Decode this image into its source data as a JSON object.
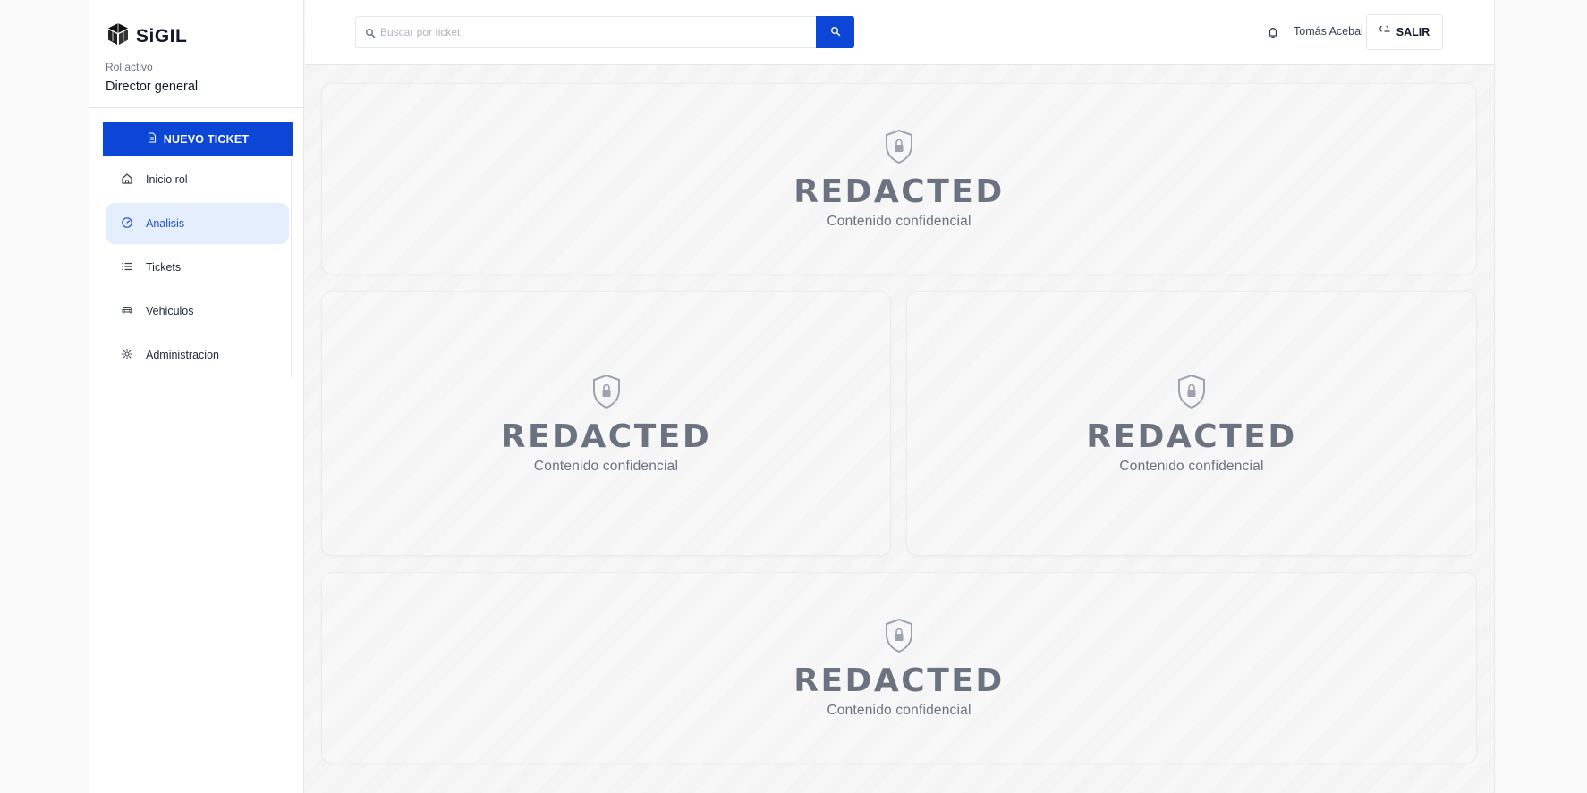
{
  "brand": {
    "name": "SiGIL",
    "logo_icon": "cube-logo-icon"
  },
  "role": {
    "label": "Rol activo",
    "value": "Director general"
  },
  "new_ticket": {
    "label": "NUEVO TICKET",
    "icon": "document-icon"
  },
  "nav": {
    "items": [
      {
        "label": "Inicio rol",
        "icon": "home-icon",
        "active": false
      },
      {
        "label": "Analisis",
        "icon": "gauge-icon",
        "active": true
      },
      {
        "label": "Tickets",
        "icon": "list-icon",
        "active": false
      },
      {
        "label": "Vehiculos",
        "icon": "car-icon",
        "active": false
      },
      {
        "label": "Administracion",
        "icon": "gear-icon",
        "active": false
      }
    ]
  },
  "search": {
    "placeholder": "Buscar por ticket",
    "value": ""
  },
  "header": {
    "user_name": "Tomás Acebal",
    "logout_label": "SALIR"
  },
  "cards": [
    {
      "title": "REDACTED",
      "subtitle": "Contenido confidencial",
      "icon": "shield-lock-icon"
    },
    {
      "title": "REDACTED",
      "subtitle": "Contenido confidencial",
      "icon": "shield-lock-icon"
    },
    {
      "title": "REDACTED",
      "subtitle": "Contenido confidencial",
      "icon": "shield-lock-icon"
    },
    {
      "title": "REDACTED",
      "subtitle": "Contenido confidencial",
      "icon": "shield-lock-icon"
    }
  ],
  "colors": {
    "primary": "#0b46d6",
    "active_bg": "#e4eefc",
    "active_text": "#1d4ed8",
    "muted": "#6b7280"
  }
}
